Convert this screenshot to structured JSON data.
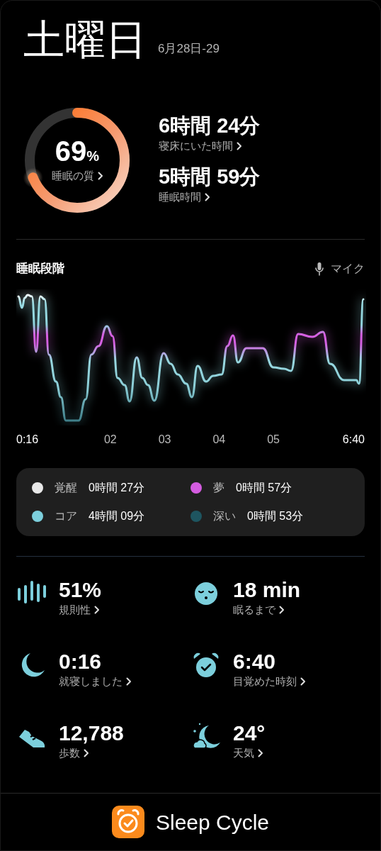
{
  "header": {
    "day": "土曜日",
    "date_range": "6月28日-29"
  },
  "quality": {
    "level": 0.69,
    "value": "69",
    "unit": "%",
    "label": "睡眠の質"
  },
  "durations": [
    {
      "value": "6時間 24分",
      "label": "寝床にいた時間"
    },
    {
      "value": "5時間 59分",
      "label": "睡眠時間"
    }
  ],
  "stages": {
    "title": "睡眠段階",
    "mic_label": "マイク",
    "x_labels": [
      "0:16",
      "02",
      "03",
      "04",
      "05",
      "6:40"
    ],
    "legend": [
      {
        "name": "覚醒",
        "duration": "0時間 27分",
        "color": "#e8e8e8"
      },
      {
        "name": "夢",
        "duration": "0時間 57分",
        "color": "#d45ce0"
      },
      {
        "name": "コア",
        "duration": "4時間 09分",
        "color": "#7ccfdc"
      },
      {
        "name": "深い",
        "duration": "0時間 53分",
        "color": "#1e5560"
      }
    ]
  },
  "stats": [
    {
      "kind": "regularity",
      "value": "51%",
      "label": "規則性"
    },
    {
      "kind": "fall_asleep",
      "value": "18 min",
      "label": "眠るまで"
    },
    {
      "kind": "bedtime",
      "value": "0:16",
      "label": "就寝しました"
    },
    {
      "kind": "wake",
      "value": "6:40",
      "label": "目覚めた時刻"
    },
    {
      "kind": "steps",
      "value": "12,788",
      "label": "歩数"
    },
    {
      "kind": "weather",
      "value": "24°",
      "label": "天気"
    }
  ],
  "footer": {
    "brand": "Sleep Cycle"
  }
}
